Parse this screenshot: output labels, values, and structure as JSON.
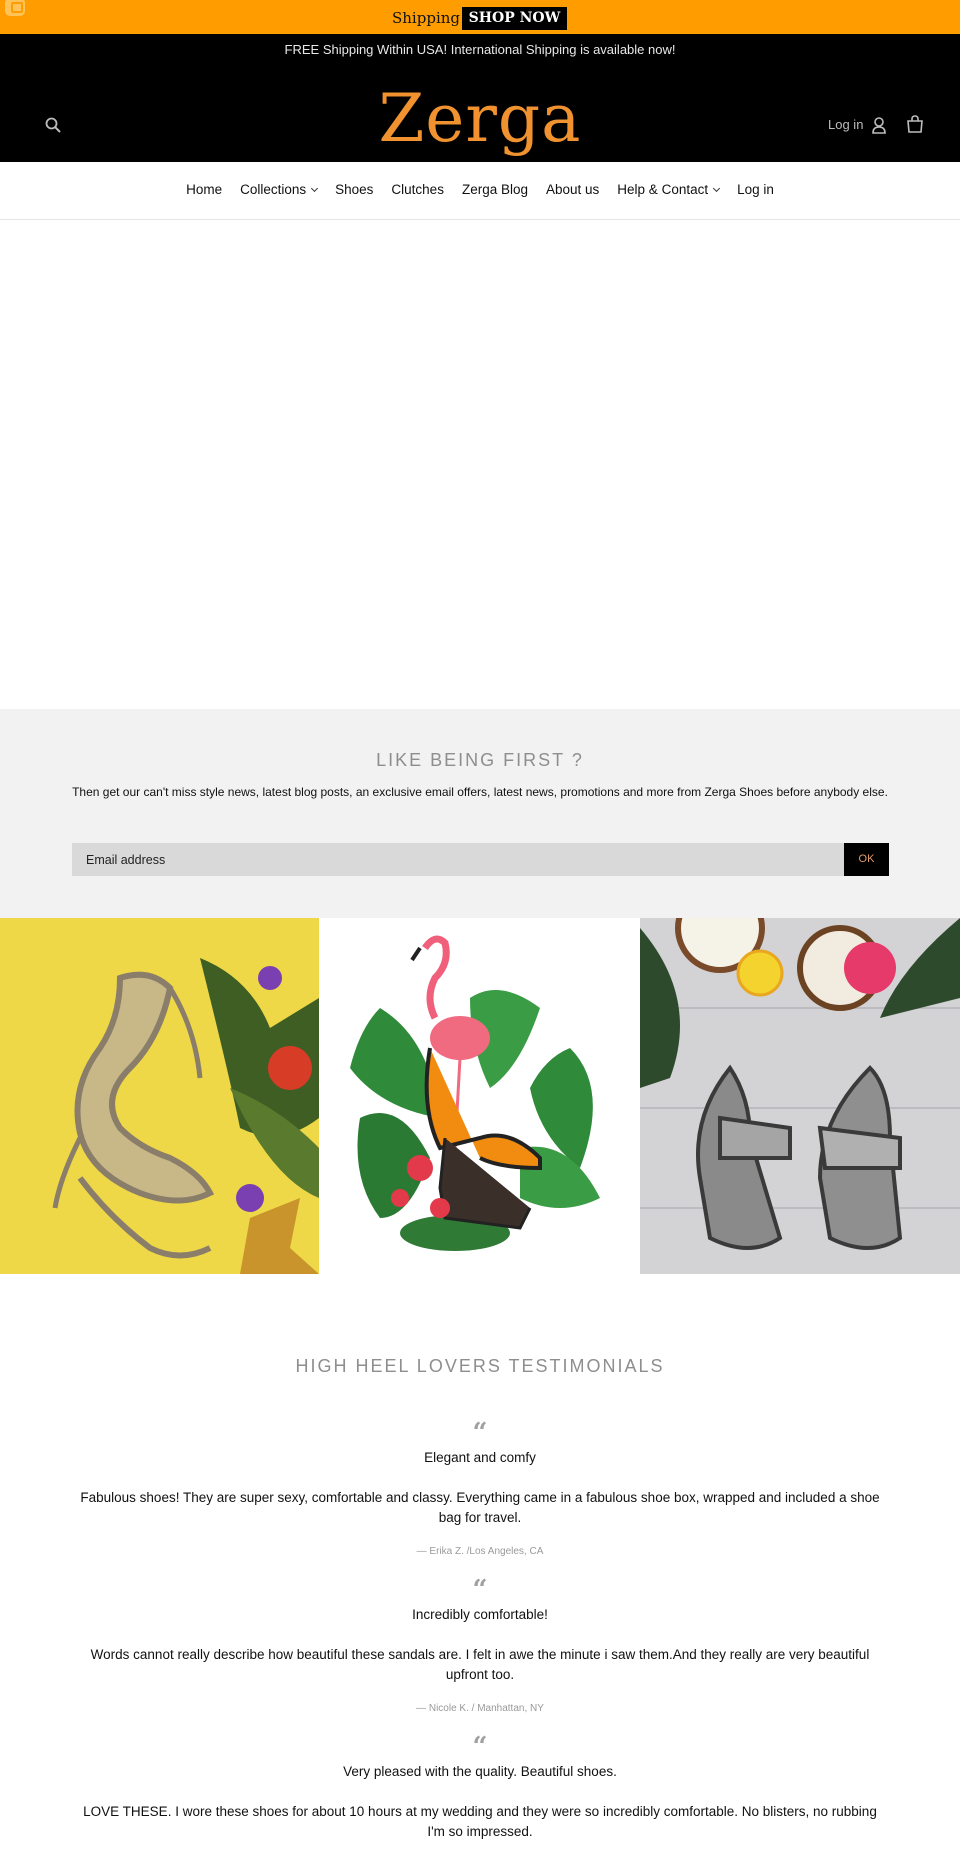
{
  "promo": {
    "text": "Shipping",
    "button_label": "SHOP NOW"
  },
  "header": {
    "shipping_note": "FREE Shipping Within USA! International Shipping is available now!",
    "logo": "Zerga",
    "login_label": "Log in"
  },
  "nav": {
    "items": [
      {
        "label": "Home",
        "dropdown": false
      },
      {
        "label": "Collections",
        "dropdown": true
      },
      {
        "label": "Shoes",
        "dropdown": false
      },
      {
        "label": "Clutches",
        "dropdown": false
      },
      {
        "label": "Zerga Blog",
        "dropdown": false
      },
      {
        "label": "About us",
        "dropdown": false
      },
      {
        "label": "Help & Contact",
        "dropdown": true
      },
      {
        "label": "Log in",
        "dropdown": false
      }
    ]
  },
  "newsletter": {
    "title": "LIKE BEING FIRST ?",
    "text": "Then get our can't miss style news, latest blog posts, an exclusive email offers, latest news, promotions and more from Zerga Shoes before anybody else.",
    "placeholder": "Email address",
    "button_label": "OK"
  },
  "testimonials": {
    "title": "HIGH HEEL LOVERS TESTIMONIALS",
    "items": [
      {
        "heading": "Elegant and comfy",
        "body": "Fabulous shoes! They are super sexy, comfortable and classy. Everything came in a fabulous shoe box, wrapped and included a shoe bag for travel.",
        "author": "— Erika Z. /Los Angeles, CA"
      },
      {
        "heading": "Incredibly comfortable!",
        "body": "Words cannot really describe how beautiful these sandals are. I felt in awe the minute i saw them.And they really are very beautiful upfront too.",
        "author": "— Nicole K. / Manhattan, NY"
      },
      {
        "heading": "Very pleased with the quality. Beautiful shoes.",
        "body": "LOVE THESE. I wore these shoes for about 10 hours at my wedding and they were so incredibly comfortable. No blisters, no rubbing I'm so impressed.",
        "author": ""
      }
    ]
  },
  "colors": {
    "promo_bar": "#ff9d00",
    "logo": "#f0922f",
    "header_bg": "#000000",
    "newsletter_bg": "#f2f2f2"
  }
}
